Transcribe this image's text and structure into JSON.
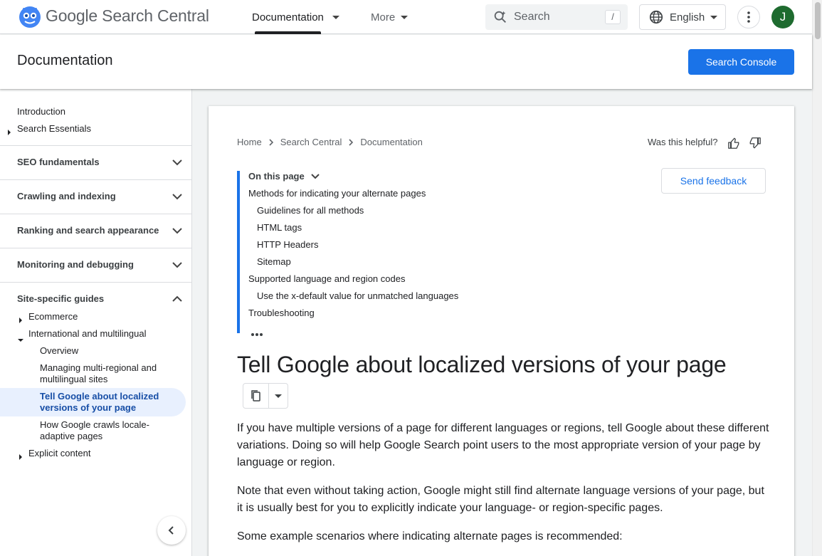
{
  "header": {
    "brand_google": "Google",
    "brand_product": "Search Central",
    "tabs": [
      {
        "label": "Documentation"
      },
      {
        "label": "More"
      }
    ],
    "search_placeholder": "Search",
    "search_shortcut": "/",
    "language": "English",
    "avatar_initial": "J"
  },
  "titlebar": {
    "title": "Documentation",
    "search_console_label": "Search Console"
  },
  "sidebar": {
    "intro": "Introduction",
    "search_essentials": "Search Essentials",
    "sections": [
      {
        "label": "SEO fundamentals"
      },
      {
        "label": "Crawling and indexing"
      },
      {
        "label": "Ranking and search appearance"
      },
      {
        "label": "Monitoring and debugging"
      },
      {
        "label": "Site-specific guides"
      }
    ],
    "ecommerce": "Ecommerce",
    "international": "International and multilingual",
    "overview": "Overview",
    "managing_1": "Managing multi-regional and",
    "managing_2": "multilingual sites",
    "active_1": "Tell Google about localized",
    "active_2": "versions of your page",
    "crawl_1": "How Google crawls locale-",
    "crawl_2": "adaptive pages",
    "explicit": "Explicit content"
  },
  "breadcrumb": [
    "Home",
    "Search Central",
    "Documentation"
  ],
  "helpful_label": "Was this helpful?",
  "feedback_label": "Send feedback",
  "toc": {
    "heading": "On this page",
    "items": [
      "Methods for indicating your alternate pages",
      "Guidelines for all methods",
      "HTML tags",
      "HTTP Headers",
      "Sitemap",
      "Supported language and region codes",
      "Use the x-default value for unmatched languages",
      "Troubleshooting"
    ]
  },
  "article": {
    "title": "Tell Google about localized versions of your page",
    "p1": "If you have multiple versions of a page for different languages or regions, tell Google about these different variations. Doing so will help Google Search point users to the most appropriate version of your page by language or region.",
    "p2": "Note that even without taking action, Google might still find alternate language versions of your page, but it is usually best for you to explicitly indicate your language- or region-specific pages.",
    "p3": "Some example scenarios where indicating alternate pages is recommended:"
  },
  "colors": {
    "accent": "#1a73e8",
    "active_bg": "#e8f0fe",
    "avatar_bg": "#1e6b2f"
  }
}
